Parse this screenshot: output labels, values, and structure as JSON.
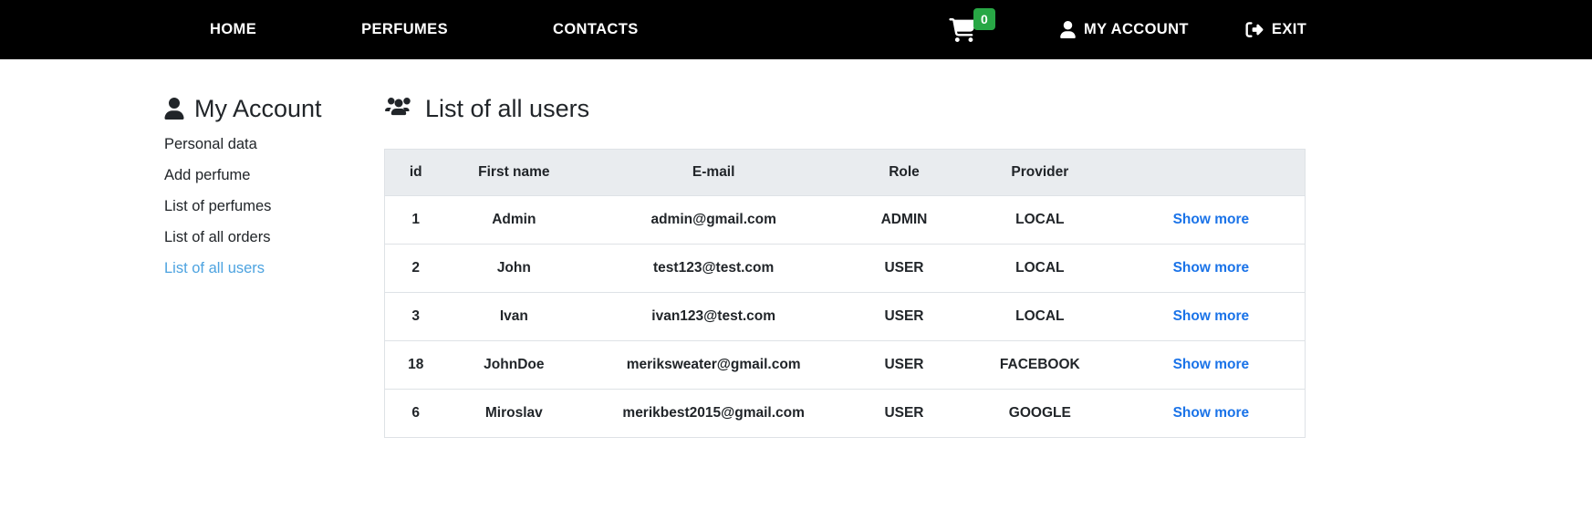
{
  "navbar": {
    "links": [
      {
        "label": "HOME",
        "name": "nav-link-home"
      },
      {
        "label": "PERFUMES",
        "name": "nav-link-perfumes"
      },
      {
        "label": "CONTACTS",
        "name": "nav-link-contacts"
      }
    ],
    "cart": {
      "icon": "shopping-cart-icon",
      "badge_count": "0",
      "badge_color": "#28a745"
    },
    "account": {
      "label": "MY ACCOUNT",
      "icon": "user-icon"
    },
    "exit": {
      "label": "EXIT",
      "icon": "sign-out-icon"
    },
    "background_color": "#000000",
    "text_color": "#ffffff"
  },
  "sidebar": {
    "title": "My Account",
    "title_icon": "user-icon",
    "items": [
      {
        "label": "Personal data",
        "active": false
      },
      {
        "label": "Add perfume",
        "active": false
      },
      {
        "label": "List of perfumes",
        "active": false
      },
      {
        "label": "List of all orders",
        "active": false
      },
      {
        "label": "List of all users",
        "active": true
      }
    ],
    "active_color": "#4da3e0"
  },
  "main": {
    "title": "List of all users",
    "title_icon": "users-group-icon",
    "table": {
      "headers": [
        "id",
        "First name",
        "E-mail",
        "Role",
        "Provider",
        ""
      ],
      "header_bg": "#e9ecef",
      "action_label": "Show more",
      "action_color": "#1a73e8",
      "rows": [
        {
          "id": "1",
          "first_name": "Admin",
          "email": "admin@gmail.com",
          "role": "ADMIN",
          "provider": "LOCAL",
          "action": "Show more"
        },
        {
          "id": "2",
          "first_name": "John",
          "email": "test123@test.com",
          "role": "USER",
          "provider": "LOCAL",
          "action": "Show more"
        },
        {
          "id": "3",
          "first_name": "Ivan",
          "email": "ivan123@test.com",
          "role": "USER",
          "provider": "LOCAL",
          "action": "Show more"
        },
        {
          "id": "18",
          "first_name": "JohnDoe",
          "email": "meriksweater@gmail.com",
          "role": "USER",
          "provider": "FACEBOOK",
          "action": "Show more"
        },
        {
          "id": "6",
          "first_name": "Miroslav",
          "email": "merikbest2015@gmail.com",
          "role": "USER",
          "provider": "GOOGLE",
          "action": "Show more"
        }
      ]
    }
  }
}
